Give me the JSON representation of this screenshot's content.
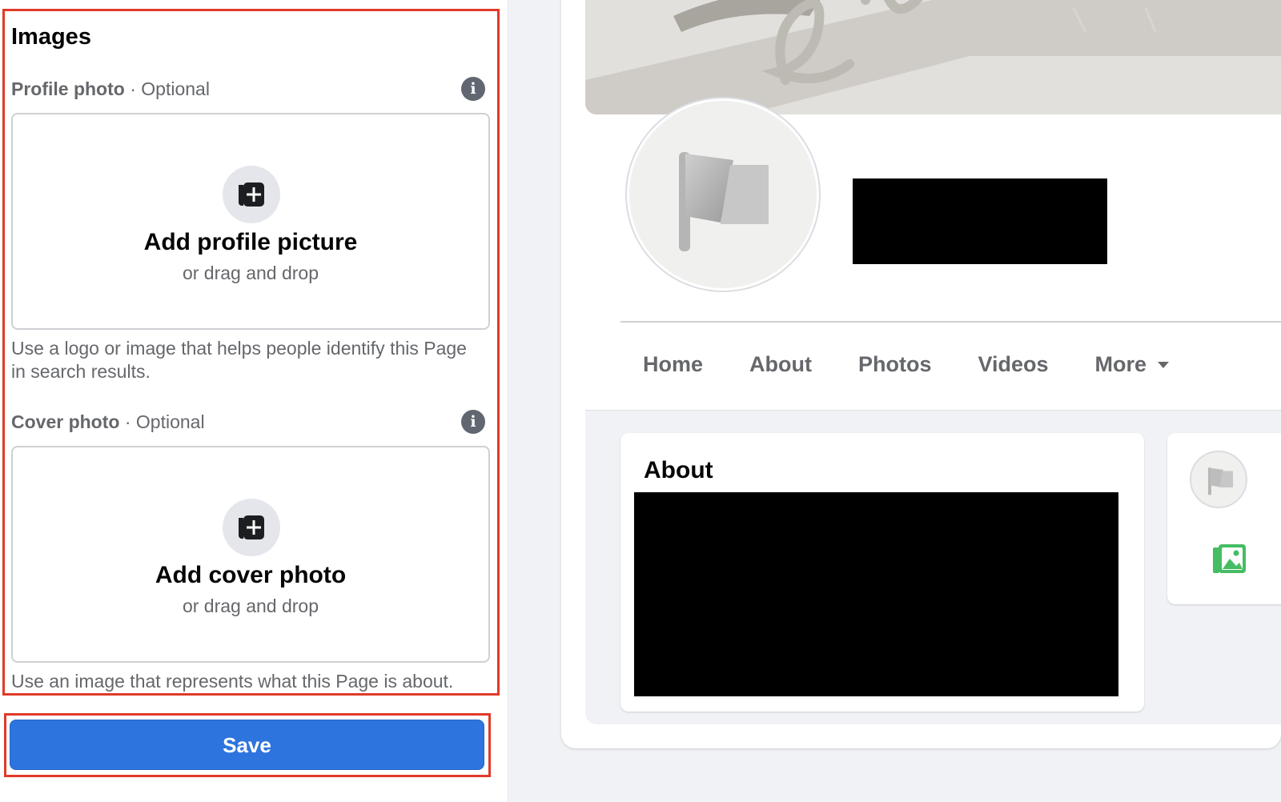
{
  "images_section": {
    "title": "Images",
    "profile_photo": {
      "label": "Profile photo",
      "optional": "· Optional",
      "upload_title": "Add profile picture",
      "upload_sub": "or drag and drop",
      "helper": "Use a logo or image that helps people identify this Page in search results."
    },
    "cover_photo": {
      "label": "Cover photo",
      "optional": "· Optional",
      "upload_title": "Add cover photo",
      "upload_sub": "or drag and drop",
      "helper": "Use an image that represents what this Page is about."
    },
    "info_glyph": "i"
  },
  "actions": {
    "save_label": "Save"
  },
  "preview": {
    "tabs": [
      "Home",
      "About",
      "Photos",
      "Videos",
      "More"
    ],
    "about_title": "About"
  },
  "colors": {
    "accent_blue": "#2d74df",
    "highlight_red": "#e03a2a",
    "secondary_text": "#65676b",
    "photo_green": "#45bd62"
  },
  "icons": [
    "info-icon",
    "add-photo-icon",
    "flag-icon",
    "photo-icon",
    "caret-down-icon"
  ]
}
